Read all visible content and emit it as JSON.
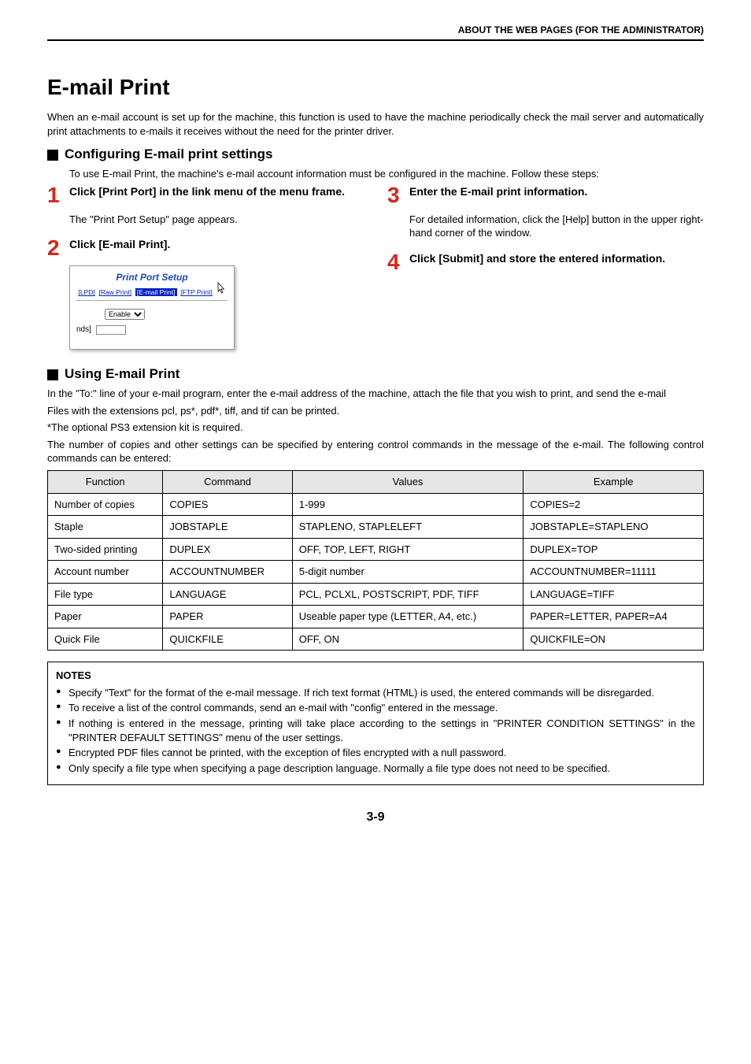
{
  "header": "ABOUT THE WEB PAGES (FOR THE ADMINISTRATOR)",
  "title": "E-mail Print",
  "intro": "When an e-mail account is set up for the machine, this function is used to have the machine periodically check the mail server and automatically print attachments to e-mails it receives without the need for the printer driver.",
  "section1": {
    "heading": "Configuring E-mail print settings",
    "lead": "To use E-mail Print, the machine's e-mail account information must be configured in the machine. Follow these steps:",
    "steps": [
      {
        "num": "1",
        "title": "Click [Print Port] in the link menu of the menu frame.",
        "body": "The \"Print Port Setup\" page appears."
      },
      {
        "num": "2",
        "title": "Click [E-mail Print]."
      },
      {
        "num": "3",
        "title": "Enter the E-mail print information.",
        "body": "For detailed information, click the [Help] button in the upper right-hand corner of the window."
      },
      {
        "num": "4",
        "title": "Click [Submit] and store the entered information."
      }
    ],
    "screenshot": {
      "title": "Print Port Setup",
      "links": [
        "[LPD]",
        "[Raw Print]",
        "[E-mail Print]",
        "[FTP Print]"
      ],
      "selected_index": 2,
      "enable_label": "Enable",
      "nds_label": "nds]"
    }
  },
  "section2": {
    "heading": "Using E-mail Print",
    "p1": "In the \"To:\" line of your e-mail program, enter the e-mail address of the machine, attach the file that you wish to print, and send the e-mail",
    "p2": "Files with the extensions pcl, ps*, pdf*, tiff, and tif can be printed.",
    "p3": "*The optional PS3 extension kit is required.",
    "p4": "The number of copies and other settings can be specified by entering control commands in the message of the e-mail. The following control commands can be entered:",
    "table": {
      "headers": [
        "Function",
        "Command",
        "Values",
        "Example"
      ],
      "rows": [
        [
          "Number of copies",
          "COPIES",
          "1-999",
          "COPIES=2"
        ],
        [
          "Staple",
          "JOBSTAPLE",
          "STAPLENO, STAPLELEFT",
          "JOBSTAPLE=STAPLENO"
        ],
        [
          "Two-sided printing",
          "DUPLEX",
          "OFF, TOP, LEFT, RIGHT",
          "DUPLEX=TOP"
        ],
        [
          "Account number",
          "ACCOUNTNUMBER",
          "5-digit number",
          "ACCOUNTNUMBER=11111"
        ],
        [
          "File type",
          "LANGUAGE",
          "PCL, PCLXL, POSTSCRIPT, PDF, TIFF",
          "LANGUAGE=TIFF"
        ],
        [
          "Paper",
          "PAPER",
          "Useable paper type (LETTER,  A4, etc.)",
          "PAPER=LETTER, PAPER=A4"
        ],
        [
          "Quick File",
          "QUICKFILE",
          "OFF, ON",
          "QUICKFILE=ON"
        ]
      ]
    }
  },
  "notes": {
    "title": "NOTES",
    "items": [
      "Specify \"Text\" for the format of the e-mail message. If rich text format (HTML) is used, the entered commands will be disregarded.",
      "To receive a list of the control commands, send an e-mail with \"config\" entered in the message.",
      "If nothing is entered in the message, printing will take place according to the settings in \"PRINTER CONDITION SETTINGS\" in the \"PRINTER DEFAULT SETTINGS\" menu of the user settings.",
      "Encrypted PDF files cannot be printed, with the exception of files encrypted with a null password.",
      "Only specify a file type when specifying a page description language. Normally a file type does not need to be specified."
    ]
  },
  "page_number": "3-9",
  "chart_data": {
    "type": "table",
    "title": "E-mail Print control commands",
    "columns": [
      "Function",
      "Command",
      "Values",
      "Example"
    ],
    "rows": [
      {
        "Function": "Number of copies",
        "Command": "COPIES",
        "Values": "1-999",
        "Example": "COPIES=2"
      },
      {
        "Function": "Staple",
        "Command": "JOBSTAPLE",
        "Values": "STAPLENO, STAPLELEFT",
        "Example": "JOBSTAPLE=STAPLENO"
      },
      {
        "Function": "Two-sided printing",
        "Command": "DUPLEX",
        "Values": "OFF, TOP, LEFT, RIGHT",
        "Example": "DUPLEX=TOP"
      },
      {
        "Function": "Account number",
        "Command": "ACCOUNTNUMBER",
        "Values": "5-digit number",
        "Example": "ACCOUNTNUMBER=11111"
      },
      {
        "Function": "File type",
        "Command": "LANGUAGE",
        "Values": "PCL, PCLXL, POSTSCRIPT, PDF, TIFF",
        "Example": "LANGUAGE=TIFF"
      },
      {
        "Function": "Paper",
        "Command": "PAPER",
        "Values": "Useable paper type (LETTER, A4, etc.)",
        "Example": "PAPER=LETTER, PAPER=A4"
      },
      {
        "Function": "Quick File",
        "Command": "QUICKFILE",
        "Values": "OFF, ON",
        "Example": "QUICKFILE=ON"
      }
    ]
  }
}
